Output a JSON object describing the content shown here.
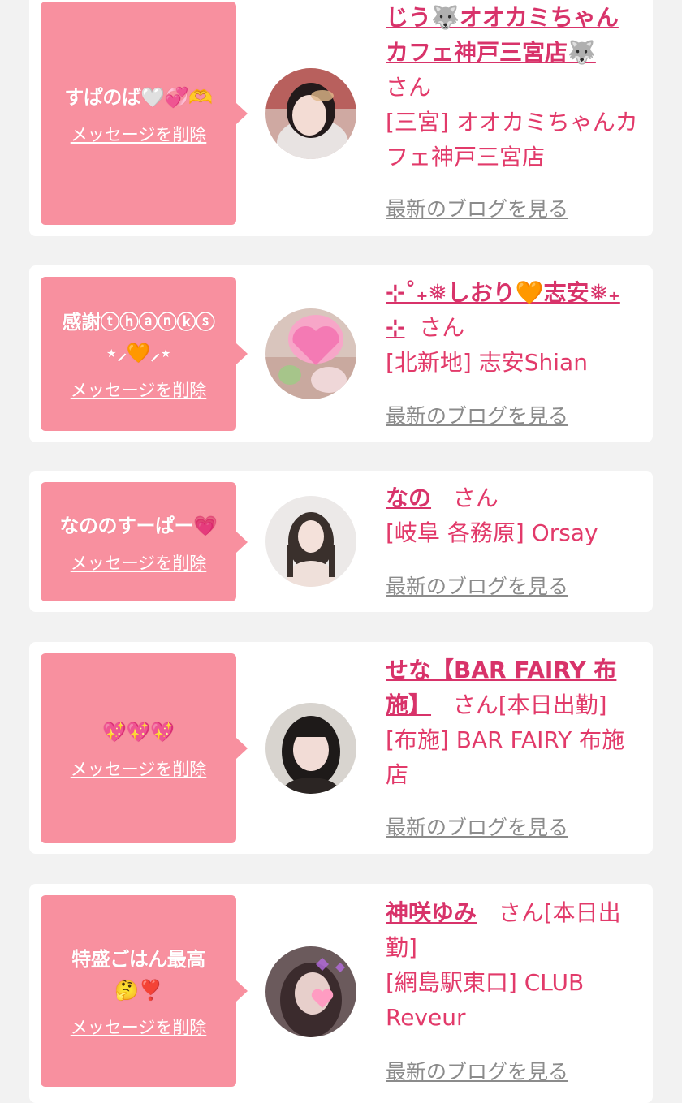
{
  "labels": {
    "delete": "メッセージを削除",
    "blog": "最新のブログを見る",
    "san": "さん"
  },
  "colors": {
    "bubble": "#f8909f",
    "name": "#d8336a",
    "text": "#e23a6a",
    "link_gray": "#8b8b8b",
    "background": "#f2f2f2"
  },
  "cards": [
    {
      "message": [
        "すぱのば🤍💞🫶"
      ],
      "name_lines": [
        "じう🐺オオカミちゃん",
        "カフェ神戸三宮店🐺"
      ],
      "san_suffix": "さん",
      "shop_lines": [
        "[三宮] オオカミちゃんカ",
        "フェ神戸三宮店"
      ]
    },
    {
      "message": [
        "感謝ⓣⓗⓐⓝⓚⓢ",
        "⋆⸝🧡⸝⋆"
      ],
      "name_lines": [
        "⊹˚₊❅しおり🧡志安❅₊",
        "⊹"
      ],
      "san_suffix": "さん",
      "shop_lines": [
        "[北新地] 志安Shian"
      ]
    },
    {
      "message": [
        "なののすーぱー💗"
      ],
      "name_lines": [
        "なの"
      ],
      "san_suffix": "さん",
      "shop_lines": [
        "[岐阜 各務原] Orsay"
      ]
    },
    {
      "message": [
        "💖💖💖"
      ],
      "name_lines": [
        "せな【BAR FAIRY 布",
        "施】"
      ],
      "san_suffix": "さん[本日出勤]",
      "shop_lines": [
        "[布施] BAR FAIRY 布施",
        "店"
      ]
    },
    {
      "message": [
        "特盛ごはん最高",
        "🤔❣️"
      ],
      "name_lines": [
        "神咲ゆみ"
      ],
      "san_suffix": "さん[本日出",
      "san_cont": "勤]",
      "shop_lines": [
        "[網島駅東口] CLUB",
        "Reveur"
      ]
    }
  ]
}
